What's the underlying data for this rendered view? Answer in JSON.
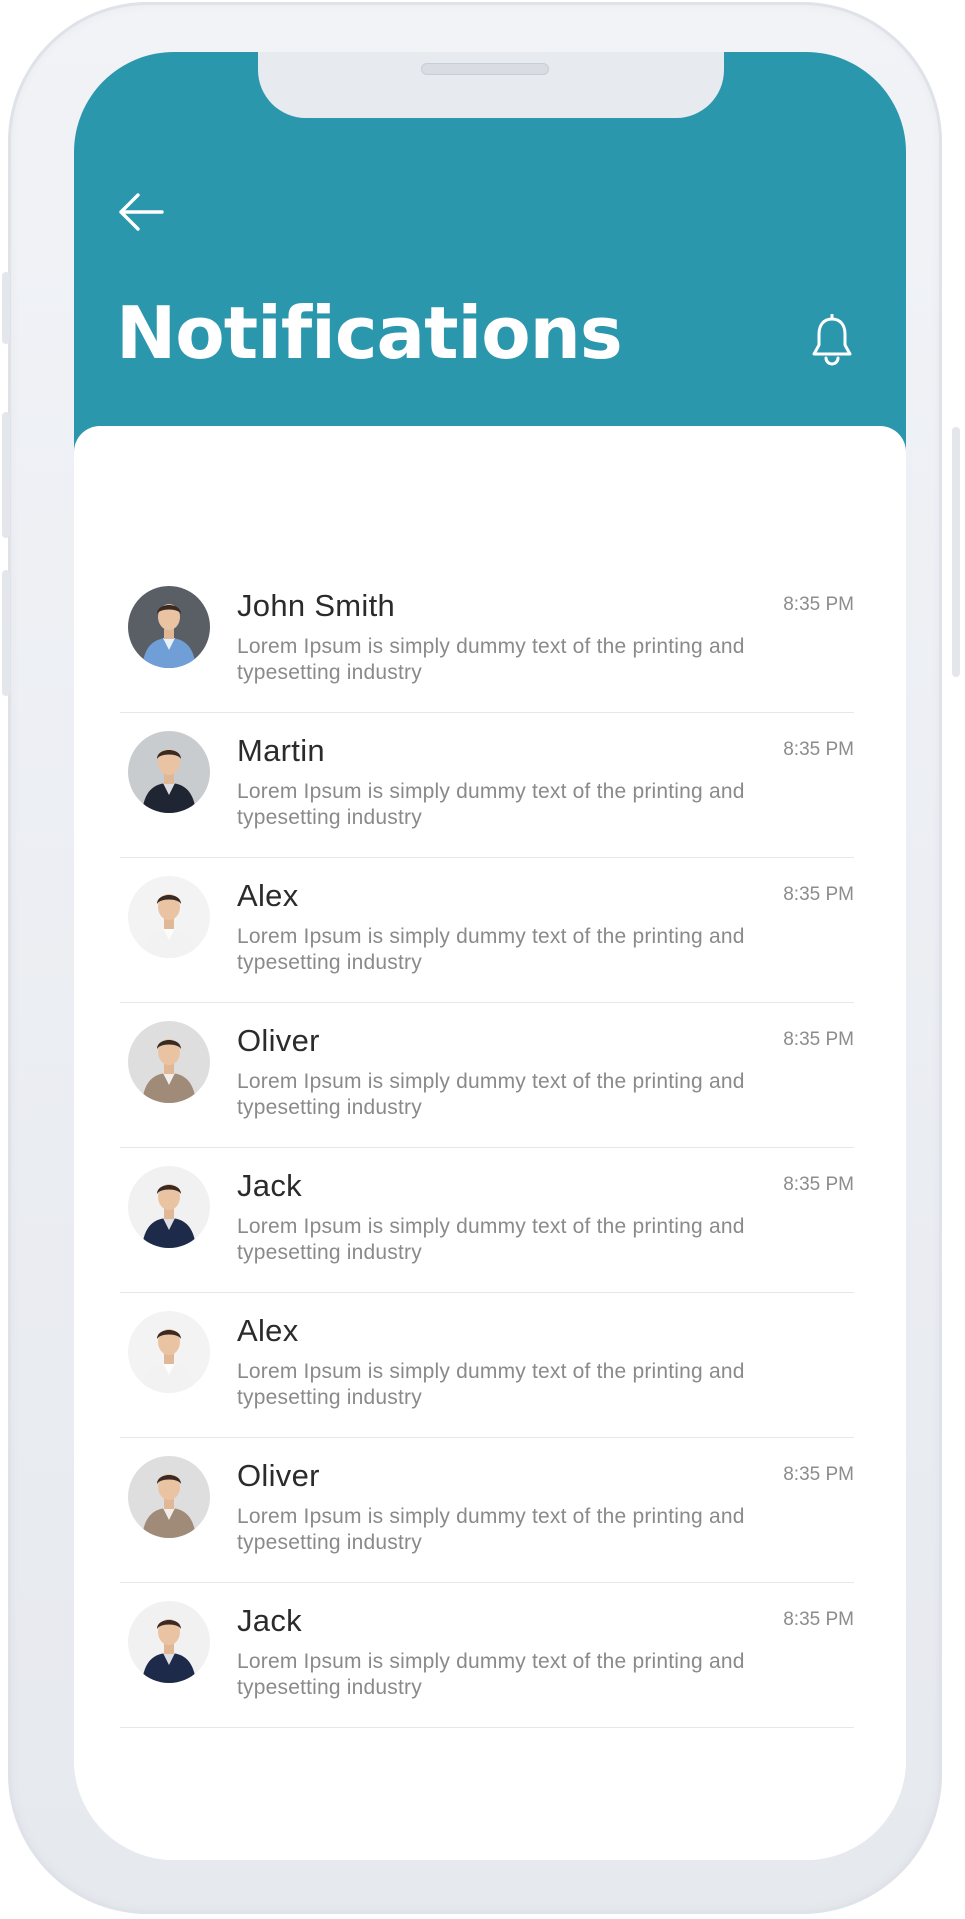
{
  "header": {
    "title": "Notifications",
    "color": "#2b97ad"
  },
  "icons": {
    "back": "arrow-left-icon",
    "bell": "bell-icon"
  },
  "notifications": [
    {
      "name": "John Smith",
      "time": "8:35 PM",
      "message": "Lorem Ipsum is simply dummy text of the printing and typesetting industry",
      "avatar_bg": "#5a5f66",
      "shirt": "#6f9fd6"
    },
    {
      "name": "Martin",
      "time": "8:35 PM",
      "message": "Lorem Ipsum is simply dummy text of the printing and typesetting industry",
      "avatar_bg": "#c9cccf",
      "shirt": "#1f2533"
    },
    {
      "name": "Alex",
      "time": "8:35 PM",
      "message": "Lorem Ipsum is simply dummy text of the printing and typesetting industry",
      "avatar_bg": "#f3f3f3",
      "shirt": "#f2f2f2"
    },
    {
      "name": "Oliver",
      "time": "8:35 PM",
      "message": "Lorem Ipsum is simply dummy text of the printing and typesetting industry",
      "avatar_bg": "#dedede",
      "shirt": "#a08a78"
    },
    {
      "name": "Jack",
      "time": "8:35 PM",
      "message": "Lorem Ipsum is simply dummy text of the printing and typesetting industry",
      "avatar_bg": "#f1f1f1",
      "shirt": "#1e2a4a"
    },
    {
      "name": "Alex",
      "time": "",
      "message": "Lorem Ipsum is simply dummy text of the printing and typesetting industry",
      "avatar_bg": "#f3f3f3",
      "shirt": "#f2f2f2"
    },
    {
      "name": "Oliver",
      "time": "8:35 PM",
      "message": "Lorem Ipsum is simply dummy text of the printing and typesetting industry",
      "avatar_bg": "#dedede",
      "shirt": "#a08a78"
    },
    {
      "name": "Jack",
      "time": "8:35 PM",
      "message": "Lorem Ipsum is simply dummy text of the printing and typesetting industry",
      "avatar_bg": "#f1f1f1",
      "shirt": "#1e2a4a"
    }
  ]
}
